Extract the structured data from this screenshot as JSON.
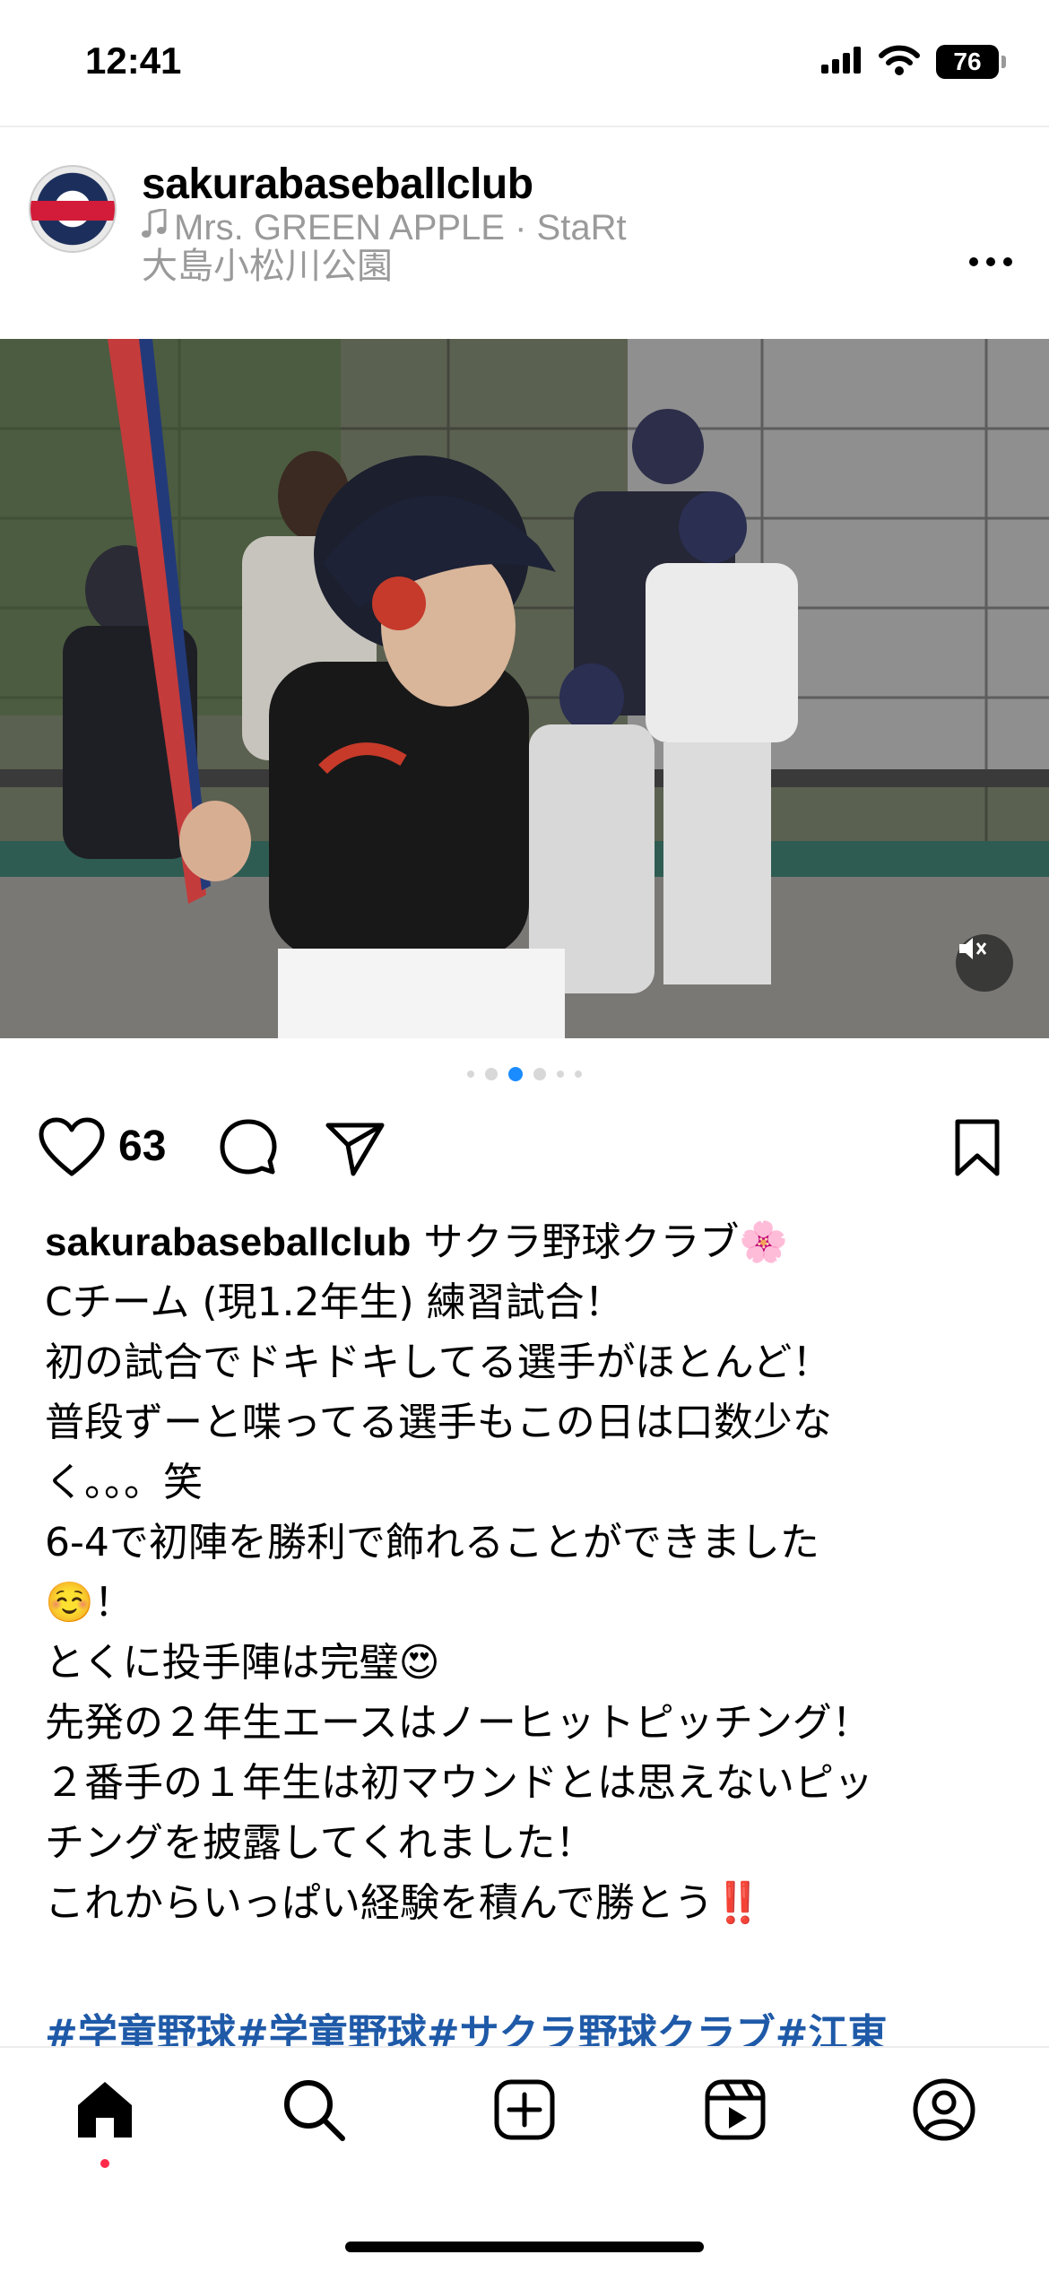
{
  "status_bar": {
    "time": "12:41",
    "battery": "76"
  },
  "post": {
    "username": "sakurabaseballclub",
    "music": "Mrs. GREEN APPLE · StaRt",
    "location": "大島小松川公園",
    "likes": "63",
    "carousel": {
      "total": 6,
      "active_index": 2
    },
    "caption_user": "sakurabaseballclub",
    "caption_lines": [
      "サクラ野球クラブ🌸",
      "Cチーム (現1.2年生) 練習試合！",
      "初の試合でドキドキしてる選手がほとんど！",
      "普段ずーと喋ってる選手もこの日は口数少な",
      "く。。。笑",
      "6-4で初陣を勝利で飾れることができました",
      "☺️！",
      "とくに投手陣は完璧😍",
      "先発の２年生エースはノーヒットピッチング！",
      "２番手の１年生は初マウンドとは思えないピッ",
      "チングを披露してくれました！",
      "これからいっぱい経験を積んで勝とう‼️"
    ],
    "hashtags": "#学童野球#学童野球#サクラ野球クラブ#江東"
  },
  "icons": {
    "signal": "signal-icon",
    "wifi": "wifi-icon",
    "battery": "battery-icon",
    "more": "more-icon",
    "music": "music-note-icon",
    "mute": "mute-icon",
    "like": "heart-icon",
    "comment": "comment-icon",
    "share": "send-icon",
    "save": "bookmark-icon",
    "nav_home": "home-icon",
    "nav_search": "search-icon",
    "nav_create": "create-icon",
    "nav_reels": "reels-icon",
    "nav_profile": "profile-icon"
  },
  "colors": {
    "link": "#1f5aa8",
    "carousel_active": "#1a8cff",
    "notification_dot": "#ff2a4b",
    "secondary_text": "#9a9a9a"
  }
}
